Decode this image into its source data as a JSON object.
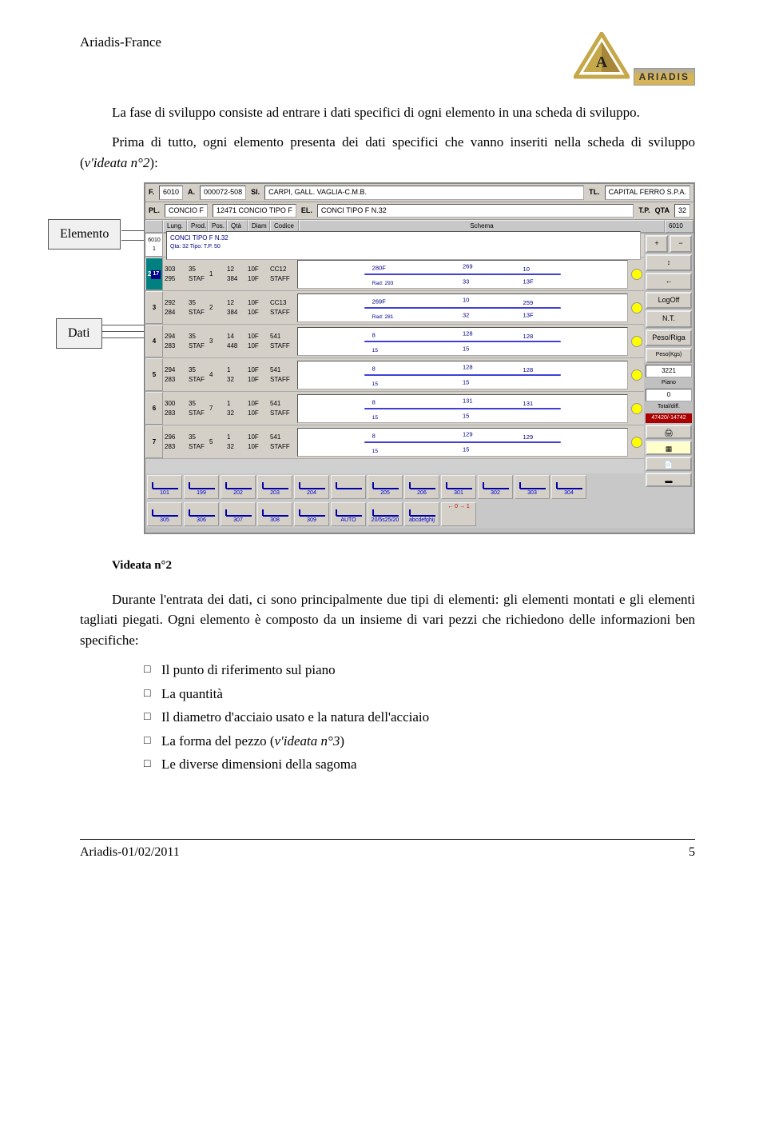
{
  "header": {
    "company": "Ariadis-France",
    "logo_text": "ARIADIS"
  },
  "intro": {
    "p1": "La fase di sviluppo consiste ad entrare i dati specifici di ogni elemento in una scheda di sviluppo.",
    "p2a": "Prima di tutto, ogni elemento presenta dei dati specifici che vanno inseriti nella scheda di sviluppo (",
    "p2b": "v'ideata n°2",
    "p2c": "):"
  },
  "callouts": {
    "elemento": "Elemento",
    "dati": "Dati"
  },
  "screenshot": {
    "hdr1": {
      "F": "F.",
      "Fv": "6010",
      "A": "A.",
      "Av": "000072-508",
      "SI": "SI.",
      "SIv": "CARPI, GALL. VAGLIA-C.M.B.",
      "TL": "TL.",
      "TLv": "CAPITAL FERRO S.P.A."
    },
    "hdr2": {
      "PL": "PL.",
      "PLv": "CONCIO F",
      "code": "12471 CONCIO TIPO F",
      "EL": "EL.",
      "ELv": "CONCI TIPO F N.32",
      "TP": "T.P.",
      "QTA": "QTA",
      "QTAv": "32"
    },
    "cols": [
      "Lung.",
      "Prod.",
      "Pos.",
      "Qtà",
      "Diam",
      "Codice",
      "Schema"
    ],
    "topright": "6010",
    "schema_title": "CONCI TIPO F N.32",
    "schema_sub": "Qta: 32 Tipo: T.P. 50",
    "rows": [
      {
        "n": "2",
        "sel": true,
        "a": [
          "303",
          "295"
        ],
        "b": [
          "35",
          "STAF"
        ],
        "pos": "1",
        "qta": [
          "12",
          "384"
        ],
        "diam": [
          "10F",
          "10F"
        ],
        "cod": [
          "CC12",
          "STAFF"
        ],
        "sch": [
          "280F",
          "269",
          "Rad: 293",
          "33",
          "10",
          "13F"
        ]
      },
      {
        "n": "3",
        "a": [
          "292",
          "284"
        ],
        "b": [
          "35",
          "STAF"
        ],
        "pos": "2",
        "qta": [
          "12",
          "384"
        ],
        "diam": [
          "10F",
          "10F"
        ],
        "cod": [
          "CC13",
          "STAFF"
        ],
        "sch": [
          "269F",
          "10",
          "Rad: 281",
          "32",
          "259",
          "13F"
        ]
      },
      {
        "n": "4",
        "a": [
          "294",
          "283"
        ],
        "b": [
          "35",
          "STAF"
        ],
        "pos": "3",
        "qta": [
          "14",
          "448"
        ],
        "diam": [
          "10F",
          "10F"
        ],
        "cod": [
          "541",
          "STAFF"
        ],
        "sch": [
          "8",
          "128",
          "15",
          "15",
          "128"
        ]
      },
      {
        "n": "5",
        "a": [
          "294",
          "283"
        ],
        "b": [
          "35",
          "STAF"
        ],
        "pos": "4",
        "qta": [
          "1",
          "32"
        ],
        "diam": [
          "10F",
          "10F"
        ],
        "cod": [
          "541",
          "STAFF"
        ],
        "sch": [
          "8",
          "128",
          "15",
          "15",
          "128"
        ]
      },
      {
        "n": "6",
        "a": [
          "300",
          "283"
        ],
        "b": [
          "35",
          "STAF"
        ],
        "pos": "7",
        "qta": [
          "1",
          "32"
        ],
        "diam": [
          "10F",
          "10F"
        ],
        "cod": [
          "541",
          "STAFF"
        ],
        "sch": [
          "8",
          "131",
          "15",
          "15",
          "131"
        ]
      },
      {
        "n": "7",
        "a": [
          "296",
          "283"
        ],
        "b": [
          "35",
          "STAF"
        ],
        "pos": "5",
        "qta": [
          "1",
          "32"
        ],
        "diam": [
          "10F",
          "10F"
        ],
        "cod": [
          "541",
          "STAFF"
        ],
        "sch": [
          "8",
          "129",
          "15",
          "15",
          "129"
        ]
      }
    ],
    "side": {
      "plus": "+",
      "minus": "−",
      "updown": "↕",
      "leftarrow": "←",
      "logoff": "LogOff",
      "nt": "N.T.",
      "pesoriga": "Peso/Riga",
      "pesokgs": "Peso(Kgs)",
      "pesokgs_v": "3221",
      "piano": "Piano",
      "piano_v": "0",
      "totaldiff": "Total/diff.",
      "totaldiff_v": "47420/-14742",
      "arrows": "← 0 → 1"
    },
    "shapes1": [
      "101",
      "199",
      "202",
      "203",
      "204",
      "",
      "205",
      "206",
      "301",
      "302",
      "303",
      "304"
    ],
    "shapes2": [
      "305",
      "306",
      "307",
      "308",
      "309",
      "AUTO",
      "20/5s25/20",
      "abcdefghij"
    ]
  },
  "caption": "Videata n°2",
  "body2": {
    "p": "Durante l'entrata dei dati, ci sono principalmente due tipi di elementi: gli elementi montati e gli elementi tagliati piegati. Ogni elemento è composto da un insieme di vari pezzi che richiedono delle informazioni ben specifiche:",
    "items": [
      "Il punto di riferimento sul piano",
      "La quantità",
      "Il diametro d'acciaio usato e la natura dell'acciaio",
      "La forma del pezzo (v'ideata n°3)",
      "Le diverse dimensioni della sagoma"
    ],
    "item4a": "La forma del pezzo (",
    "item4b": "v'ideata n°3",
    "item4c": ")"
  },
  "footer": {
    "left": "Ariadis-01/02/2011",
    "right": "5"
  }
}
